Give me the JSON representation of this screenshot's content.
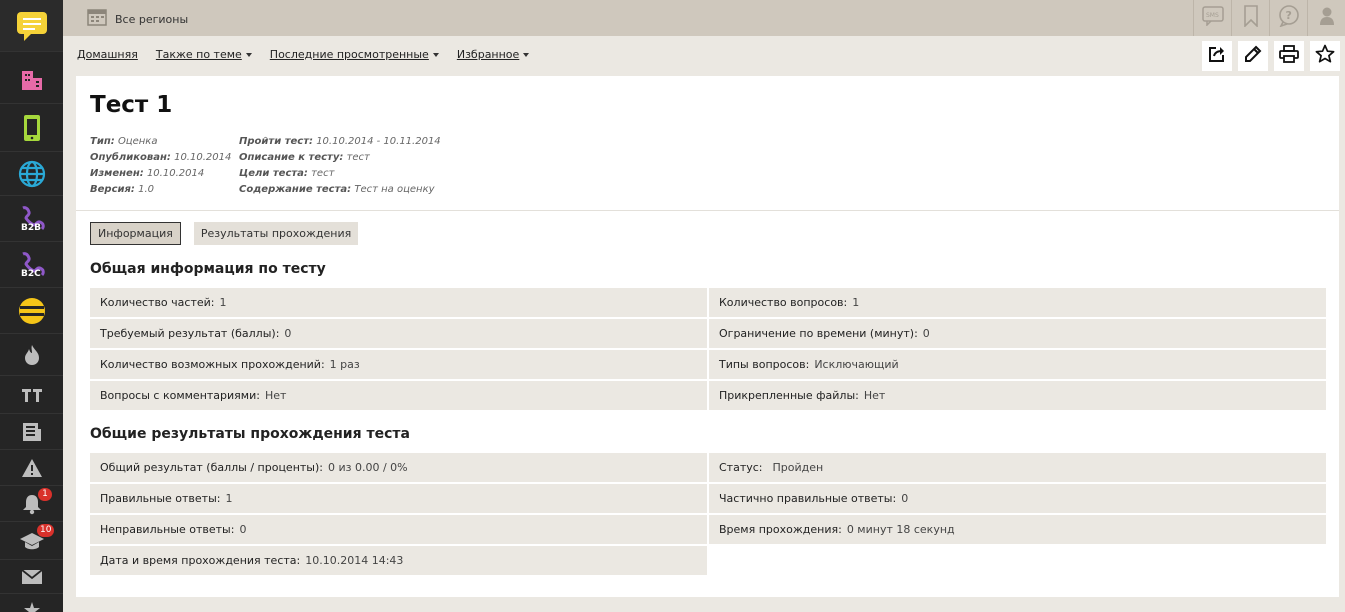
{
  "sidebar": {
    "icons": [
      {
        "name": "chat-icon",
        "color": "#f5d238"
      },
      {
        "name": "buildings-icon",
        "color": "#e76aa8"
      },
      {
        "name": "mobile-icon",
        "color": "#a6d83c"
      },
      {
        "name": "globe-icon",
        "color": "#2aa9d6"
      },
      {
        "name": "b2b-icon",
        "color": "#8f58c9",
        "label": "B2B"
      },
      {
        "name": "b2c-icon",
        "color": "#8f58c9",
        "label": "B2C"
      },
      {
        "name": "beeline-icon",
        "color": "#f5c518"
      },
      {
        "name": "flame-icon",
        "color": "#bdbdbd"
      },
      {
        "name": "text-icon",
        "color": "#bdbdbd"
      },
      {
        "name": "news-icon",
        "color": "#bdbdbd"
      },
      {
        "name": "warning-icon",
        "color": "#bdbdbd"
      },
      {
        "name": "bell-icon",
        "color": "#bdbdbd",
        "badge": "1"
      },
      {
        "name": "graduation-cap-icon",
        "color": "#bdbdbd",
        "badge": "10"
      },
      {
        "name": "mail-icon",
        "color": "#bdbdbd"
      },
      {
        "name": "star-icon",
        "color": "#bdbdbd"
      }
    ]
  },
  "topbar": {
    "region_label": "Все регионы",
    "icons": [
      "sms-icon",
      "bookmark-icon",
      "help-icon",
      "user-icon"
    ]
  },
  "nav": {
    "home": "Домашняя",
    "related": "Также по теме",
    "recent": "Последние просмотренные",
    "favorites": "Избранное"
  },
  "actions": [
    "share-icon",
    "edit-icon",
    "print-icon",
    "favorite-star-icon"
  ],
  "page": {
    "title": "Тест 1",
    "meta_left": [
      {
        "k": "Тип:",
        "v": "Оценка"
      },
      {
        "k": "Опубликован:",
        "v": "10.10.2014"
      },
      {
        "k": "Изменен:",
        "v": "10.10.2014"
      },
      {
        "k": "Версия:",
        "v": "1.0"
      }
    ],
    "meta_right": [
      {
        "k": "Пройти тест:",
        "v": "10.10.2014 - 10.11.2014"
      },
      {
        "k": "Описание к тесту:",
        "v": "тест"
      },
      {
        "k": "Цели теста:",
        "v": "тест"
      },
      {
        "k": "Содержание теста:",
        "v": "Тест на оценку"
      }
    ]
  },
  "tabs": {
    "info": "Информация",
    "results": "Результаты прохождения"
  },
  "general": {
    "title": "Общая информация по тесту",
    "rows": [
      [
        {
          "l": "Количество частей:",
          "v": "1"
        },
        {
          "l": "Количество вопросов:",
          "v": "1"
        }
      ],
      [
        {
          "l": "Требуемый результат (баллы):",
          "v": "0"
        },
        {
          "l": "Ограничение по времени (минут):",
          "v": "0"
        }
      ],
      [
        {
          "l": "Количество возможных прохождений:",
          "v": "1 раз"
        },
        {
          "l": "Типы вопросов:",
          "v": "Исключающий"
        }
      ],
      [
        {
          "l": "Вопросы с комментариями:",
          "v": "Нет"
        },
        {
          "l": "Прикрепленные файлы:",
          "v": "Нет"
        }
      ]
    ]
  },
  "results": {
    "title": "Общие результаты прохождения теста",
    "rows": [
      [
        {
          "l": "Общий результат (баллы / проценты):",
          "v": "0 из 0.00 / 0%"
        },
        {
          "l": "Статус:",
          "v": "Пройден"
        }
      ],
      [
        {
          "l": "Правильные ответы:",
          "v": "1"
        },
        {
          "l": "Частично правильные ответы:",
          "v": "0"
        }
      ],
      [
        {
          "l": "Неправильные ответы:",
          "v": "0"
        },
        {
          "l": "Время прохождения:",
          "v": "0 минут 18 секунд"
        }
      ],
      [
        {
          "l": "Дата и время прохождения теста:",
          "v": "10.10.2014 14:43"
        }
      ]
    ]
  }
}
